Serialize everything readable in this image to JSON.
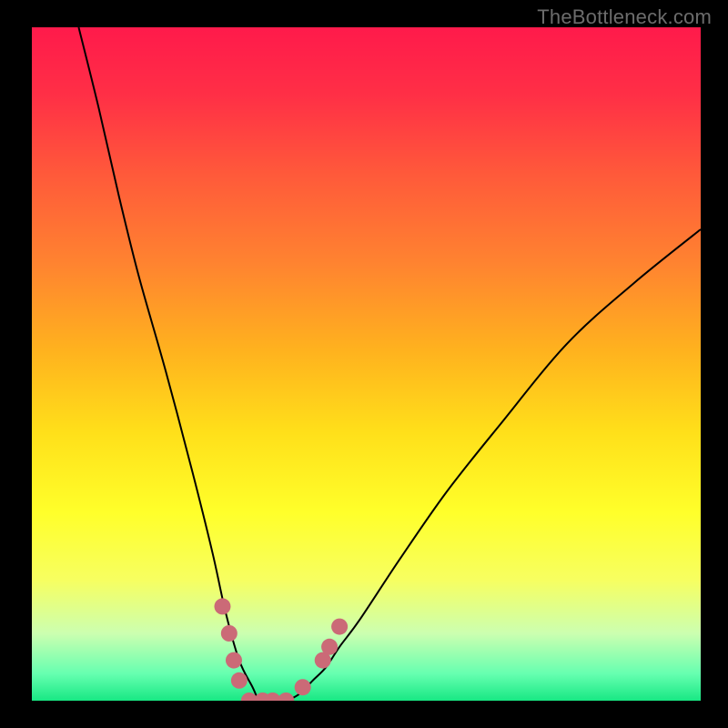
{
  "watermark": "TheBottleneck.com",
  "gradient": {
    "stops": [
      {
        "offset": 0.0,
        "color": "#ff1a4b"
      },
      {
        "offset": 0.1,
        "color": "#ff2f46"
      },
      {
        "offset": 0.22,
        "color": "#ff5a3a"
      },
      {
        "offset": 0.35,
        "color": "#ff8330"
      },
      {
        "offset": 0.48,
        "color": "#ffb21e"
      },
      {
        "offset": 0.6,
        "color": "#ffdf1a"
      },
      {
        "offset": 0.72,
        "color": "#ffff2a"
      },
      {
        "offset": 0.82,
        "color": "#f7ff60"
      },
      {
        "offset": 0.9,
        "color": "#ccffb0"
      },
      {
        "offset": 0.96,
        "color": "#66ffb0"
      },
      {
        "offset": 1.0,
        "color": "#18e884"
      }
    ]
  },
  "chart_data": {
    "type": "line",
    "title": "",
    "xlabel": "",
    "ylabel": "",
    "xlim": [
      0,
      100
    ],
    "ylim": [
      0,
      100
    ],
    "series": [
      {
        "name": "bottleneck-curve",
        "x": [
          7,
          10,
          13,
          16,
          20,
          24,
          27,
          29,
          31,
          33,
          34,
          35,
          36,
          37,
          38,
          40,
          42,
          44,
          46,
          49,
          55,
          62,
          70,
          80,
          90,
          100
        ],
        "y": [
          100,
          88,
          75,
          63,
          49,
          34,
          22,
          13,
          6,
          2,
          0,
          0,
          0,
          0,
          0,
          1,
          3,
          5,
          8,
          12,
          21,
          31,
          41,
          53,
          62,
          70
        ]
      }
    ],
    "highlight_points": {
      "name": "near-minimum-markers",
      "color": "#cb6a77",
      "points": [
        {
          "x": 28.5,
          "y": 14
        },
        {
          "x": 29.5,
          "y": 10
        },
        {
          "x": 30.2,
          "y": 6
        },
        {
          "x": 31.0,
          "y": 3
        },
        {
          "x": 32.5,
          "y": 0
        },
        {
          "x": 34.5,
          "y": 0
        },
        {
          "x": 36.0,
          "y": 0
        },
        {
          "x": 38.0,
          "y": 0
        },
        {
          "x": 40.5,
          "y": 2
        },
        {
          "x": 43.5,
          "y": 6
        },
        {
          "x": 44.5,
          "y": 8
        },
        {
          "x": 46.0,
          "y": 11
        }
      ]
    }
  }
}
